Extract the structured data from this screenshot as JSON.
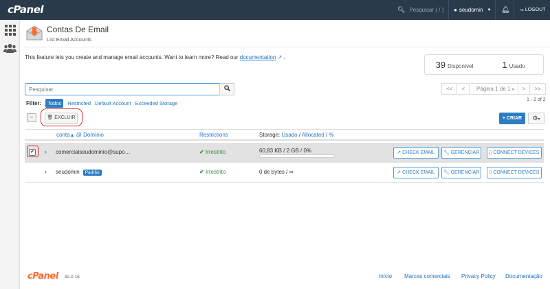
{
  "topbar": {
    "logo": "cPanel",
    "search_placeholder": "Pesquisar ( / )",
    "user": "seudomin",
    "logout": "LOGOUT"
  },
  "header": {
    "title": "Contas De Email",
    "subtitle": "List Email Accounts"
  },
  "intro": {
    "text": "This feature lets you create and manage email accounts. Want to learn more? Read our ",
    "link": "documentation",
    "end": "."
  },
  "stats": {
    "available_count": "39",
    "available_label": "Disponível",
    "used_count": "1",
    "used_label": "Usado"
  },
  "search": {
    "placeholder": "Pesquisar"
  },
  "pager": {
    "first": "<<",
    "prev": "<",
    "page": "Página 1 de 1",
    "next": ">",
    "last": ">>",
    "count": "1 - 2 of 2"
  },
  "filters": {
    "label": "Filter:",
    "options": [
      "Todos",
      "Restricted",
      "Default Account",
      "Exceeded Storage"
    ]
  },
  "toolbar": {
    "delete": "EXCLUIR",
    "create": "+ CRIAR"
  },
  "table": {
    "headers": {
      "account": "conta",
      "domain": "@ Domínio",
      "restrictions": "Restrictions",
      "storage_prefix": "Storage:",
      "used": "Usado",
      "allocated": "Allocated",
      "percent": "%"
    },
    "rows": [
      {
        "account": "comercialseudominio@supo…",
        "badge": "",
        "restriction": "Irrestrito",
        "storage": "60,83 KB / 2 GB / 0%",
        "usage_fraction": 0.0,
        "selected": true
      },
      {
        "account": "seudomin",
        "badge": "Padrão",
        "restriction": "Irrestrito",
        "storage": "0 de bytes / ∞",
        "usage_fraction": 0.0,
        "selected": false
      }
    ],
    "actions": {
      "check": "CHECK EMAIL",
      "manage": "GERENCIAR",
      "connect": "CONNECT DEVICES"
    }
  },
  "footer": {
    "logo": "cPanel",
    "version": "82.0.16",
    "links": [
      "Início",
      "Marcas comerciais",
      "Privacy Policy",
      "Documentação"
    ]
  },
  "colors": {
    "topbar": "#293a4a",
    "accent": "#2d7cc4",
    "highlight": "#d7272b",
    "brand": "#ff6c2c"
  }
}
